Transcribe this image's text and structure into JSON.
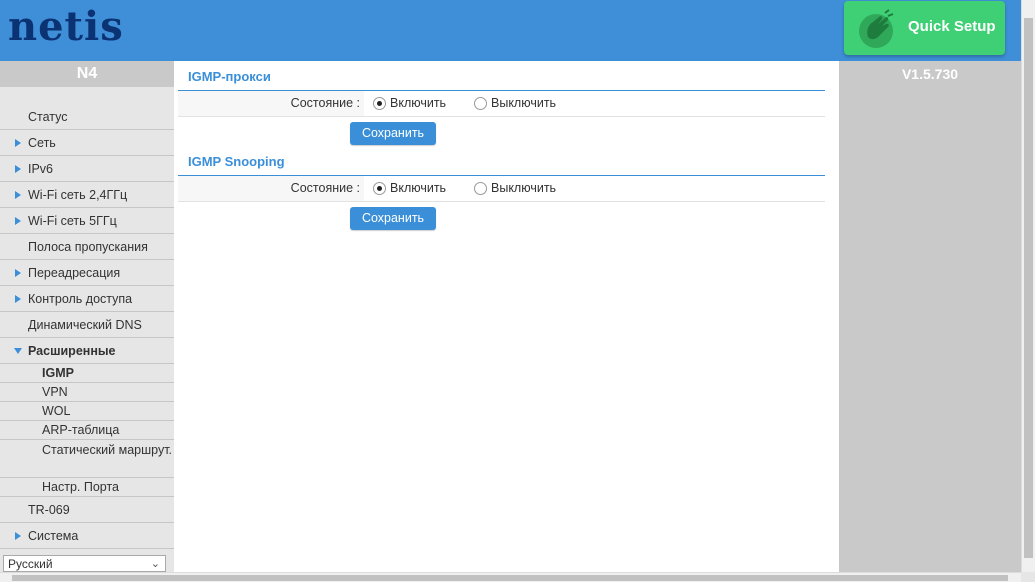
{
  "header": {
    "logo": "netis",
    "quick_setup_label": "Quick Setup",
    "quick_setup_icon": "hand-wave-icon"
  },
  "sidebar": {
    "model": "N4",
    "items": [
      {
        "label": "Статус",
        "arrow": "none"
      },
      {
        "label": "Сеть",
        "arrow": "right"
      },
      {
        "label": "IPv6",
        "arrow": "right"
      },
      {
        "label": "Wi-Fi сеть 2,4ГГц",
        "arrow": "right"
      },
      {
        "label": "Wi-Fi сеть 5ГГц",
        "arrow": "right"
      },
      {
        "label": "Полоса пропускания",
        "arrow": "none"
      },
      {
        "label": "Переадресация",
        "arrow": "right"
      },
      {
        "label": "Контроль доступа",
        "arrow": "right"
      },
      {
        "label": "Динамический DNS",
        "arrow": "none"
      },
      {
        "label": "Расширенные",
        "arrow": "down",
        "expanded": true
      }
    ],
    "subitems": [
      {
        "label": "IGMP",
        "active": true
      },
      {
        "label": "VPN"
      },
      {
        "label": "WOL"
      },
      {
        "label": "ARP-таблица"
      },
      {
        "label": "Статический маршрут."
      },
      {
        "label": "Настр. Порта"
      }
    ],
    "bottom_items": [
      {
        "label": "TR-069",
        "arrow": "none"
      },
      {
        "label": "Система",
        "arrow": "right"
      }
    ],
    "language": "Русский"
  },
  "main": {
    "sections": [
      {
        "title": "IGMP-прокси",
        "state_label": "Состояние :",
        "options": [
          "Включить",
          "Выключить"
        ],
        "selected": "Включить",
        "save_label": "Сохранить"
      },
      {
        "title": "IGMP Snooping",
        "state_label": "Состояние :",
        "options": [
          "Включить",
          "Выключить"
        ],
        "selected": "Включить",
        "save_label": "Сохранить"
      }
    ]
  },
  "version": "V1.5.730",
  "colors": {
    "header_bg": "#3e8fd8",
    "logo": "#0b3272",
    "quick_setup_bg": "#3fcf74",
    "accent": "#3a8fd8",
    "sidebar_bg": "#e6e6e6",
    "panel_gray": "#c9c9c9"
  }
}
